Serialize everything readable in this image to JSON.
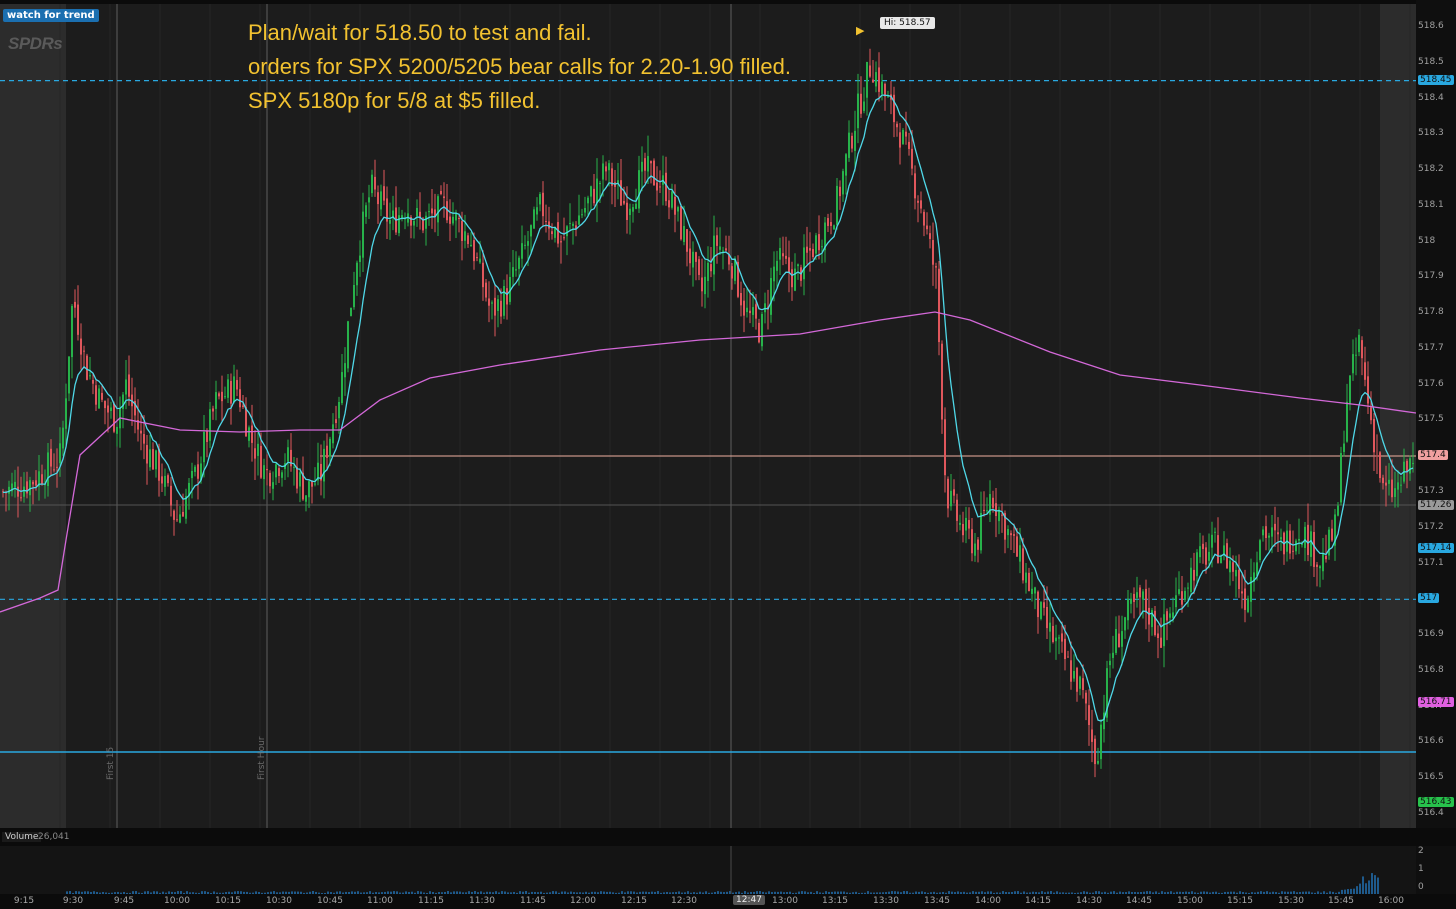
{
  "chart": {
    "watch_badge": "watch for trend",
    "symbol_watermark": "SPDRs",
    "annotation": [
      "Plan/wait for 518.50 to test and fail.",
      "orders for SPX 5200/5205 bear calls for 2.20-1.90 filled.",
      "SPX 5180p for 5/8 at $5 filled."
    ],
    "hi_label": "Hi: 518.57",
    "markers": [
      "First 15",
      "First Hour"
    ],
    "price_ticks": [
      "518.6",
      "518.5",
      "518.4",
      "518.3",
      "518.2",
      "518.1",
      "518",
      "517.9",
      "517.8",
      "517.7",
      "517.6",
      "517.5",
      "517.3",
      "517.2",
      "517.1",
      "516.9",
      "516.8",
      "516.7",
      "516.6",
      "516.5",
      "516.4"
    ],
    "price_tags": [
      {
        "text": "518.45",
        "color": "#29a8e0"
      },
      {
        "text": "517.4",
        "color": "#f0a0a0"
      },
      {
        "text": "517.26",
        "color": "#9a9a9a"
      },
      {
        "text": "517.14",
        "color": "#29a8e0"
      },
      {
        "text": "517",
        "color": "#29a8e0"
      },
      {
        "text": "516.71",
        "color": "#e060e0"
      },
      {
        "text": "516.43",
        "color": "#27c24c"
      }
    ],
    "volume_label": "Volume",
    "volume_value": "26,041",
    "volume_ticks": [
      "2",
      "1",
      "0"
    ],
    "time_labels": [
      "9:15",
      "9:30",
      "9:45",
      "10:00",
      "10:15",
      "10:30",
      "10:45",
      "11:00",
      "11:15",
      "11:30",
      "11:45",
      "12:00",
      "12:15",
      "12:30",
      "13:00",
      "13:15",
      "13:30",
      "13:45",
      "14:00",
      "14:15",
      "14:30",
      "14:45",
      "15:00",
      "15:15",
      "15:30",
      "15:45",
      "16:00"
    ],
    "cursor_time": "12:47",
    "colors": {
      "background": "#1c1c1c",
      "up_candle": "#27b24a",
      "down_candle": "#e0575c",
      "ema": "#4fd8e8",
      "vwap": "#d368d8",
      "level_line": "#29a8e0",
      "annotation": "#f2c230"
    }
  }
}
